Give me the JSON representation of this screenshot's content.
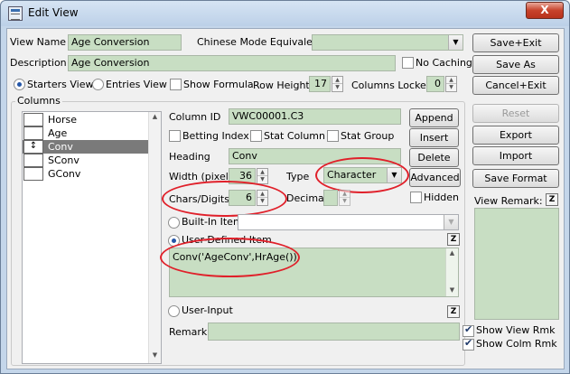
{
  "window": {
    "title": "Edit View",
    "close_glyph": "X"
  },
  "header": {
    "view_name_label": "View Name",
    "view_name_value": "Age Conversion",
    "chinese_mode_label": "Chinese Mode Equivalent",
    "chinese_mode_value": "",
    "description_label": "Description",
    "description_value": "Age Conversion",
    "no_caching_label": "No Caching",
    "starters_view_label": "Starters View",
    "entries_view_label": "Entries View",
    "show_formula_label": "Show Formula",
    "row_height_label": "Row Height",
    "row_height_value": "17",
    "columns_locked_label": "Columns Locked",
    "columns_locked_value": "0"
  },
  "columns": {
    "group_label": "Columns",
    "items": [
      {
        "label": "Horse"
      },
      {
        "label": "Age"
      },
      {
        "label": "Conv",
        "selected": true
      },
      {
        "label": "SConv"
      },
      {
        "label": "GConv"
      }
    ]
  },
  "column_detail": {
    "column_id_label": "Column ID",
    "column_id_value": "VWC00001.C3",
    "betting_index_label": "Betting Index",
    "stat_column_label": "Stat Column",
    "stat_group_label": "Stat Group",
    "heading_label": "Heading",
    "heading_value": "Conv",
    "width_label": "Width (pixel)",
    "width_value": "36",
    "type_label": "Type",
    "type_value": "Character",
    "chars_digits_label": "Chars/Digits",
    "chars_digits_value": "6",
    "decimal_label": "Decimal",
    "decimal_value": "",
    "hidden_label": "Hidden",
    "built_in_item_label": "Built-In Item",
    "built_in_item_value": "",
    "user_defined_item_label": "User-Defined Item",
    "user_defined_formula": "Conv('AgeConv',HrAge())",
    "user_input_label": "User-Input",
    "remark_label": "Remark",
    "remark_value": "",
    "z_label": "Z"
  },
  "column_buttons": {
    "append": "Append",
    "insert": "Insert",
    "delete": "Delete",
    "advanced": "Advanced"
  },
  "right_panel": {
    "save_exit": "Save+Exit",
    "save_as": "Save As",
    "cancel_exit": "Cancel+Exit",
    "reset": "Reset",
    "export": "Export",
    "import": "Import",
    "save_format": "Save Format",
    "view_remark_label": "View Remark:",
    "show_view_rmk_label": "Show View Rmk",
    "show_colm_rmk_label": "Show Colm Rmk"
  },
  "colors": {
    "field_green": "#c8dec3",
    "annotation_red": "#e0202a",
    "selection_gray": "#7a7a7a"
  }
}
